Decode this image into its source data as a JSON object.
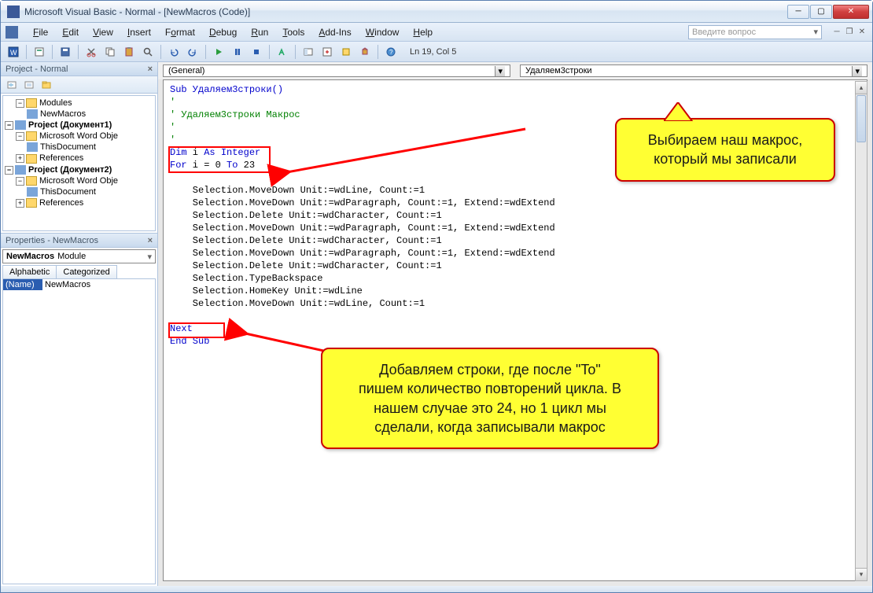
{
  "titlebar": {
    "text": "Microsoft Visual Basic - Normal - [NewMacros (Code)]"
  },
  "menu": {
    "items": [
      "File",
      "Edit",
      "View",
      "Insert",
      "Format",
      "Debug",
      "Run",
      "Tools",
      "Add-Ins",
      "Window",
      "Help"
    ],
    "question_placeholder": "Введите вопрос"
  },
  "toolbar": {
    "status": "Ln 19, Col 5"
  },
  "project": {
    "title": "Project - Normal",
    "tree": {
      "modules": "Modules",
      "newmacros": "NewMacros",
      "proj1": "Project (Документ1)",
      "mswo1": "Microsoft Word Obje",
      "thisdoc1": "ThisDocument",
      "refs1": "References",
      "proj2": "Project (Документ2)",
      "mswo2": "Microsoft Word Obje",
      "thisdoc2": "ThisDocument",
      "refs2": "References"
    }
  },
  "properties": {
    "title": "Properties - NewMacros",
    "combo_name": "NewMacros",
    "combo_type": "Module",
    "tab_alpha": "Alphabetic",
    "tab_cat": "Categorized",
    "row_key": "(Name)",
    "row_val": "NewMacros"
  },
  "code": {
    "combo_left": "(General)",
    "combo_right": "Удаляем3строки",
    "lines": {
      "l1": "Sub Удаляем3строки()",
      "l2": "'",
      "l3": "' Удаляем3строки Макрос",
      "l4": "'",
      "l5": "'",
      "l6a": "Dim",
      "l6b": " i ",
      "l6c": "As Integer",
      "l7a": "For",
      "l7b": " i = 0 ",
      "l7c": "To",
      "l7d": " 23",
      "l9": "    Selection.MoveDown Unit:=wdLine, Count:=1",
      "l10": "    Selection.MoveDown Unit:=wdParagraph, Count:=1, Extend:=wdExtend",
      "l11": "    Selection.Delete Unit:=wdCharacter, Count:=1",
      "l12": "    Selection.MoveDown Unit:=wdParagraph, Count:=1, Extend:=wdExtend",
      "l13": "    Selection.Delete Unit:=wdCharacter, Count:=1",
      "l14": "    Selection.MoveDown Unit:=wdParagraph, Count:=1, Extend:=wdExtend",
      "l15": "    Selection.Delete Unit:=wdCharacter, Count:=1",
      "l16": "    Selection.TypeBackspace",
      "l17": "    Selection.HomeKey Unit:=wdLine",
      "l18": "    Selection.MoveDown Unit:=wdLine, Count:=1",
      "l20": "Next",
      "l21": "End Sub"
    }
  },
  "callouts": {
    "top": "Выбираем наш макрос,\nкоторый мы записали",
    "bottom": "Добавляем строки, где после \"To\"\nпишем количество повторений цикла. В\nнашем случае это 24, но 1 цикл мы\nсделали, когда записывали макрос"
  }
}
